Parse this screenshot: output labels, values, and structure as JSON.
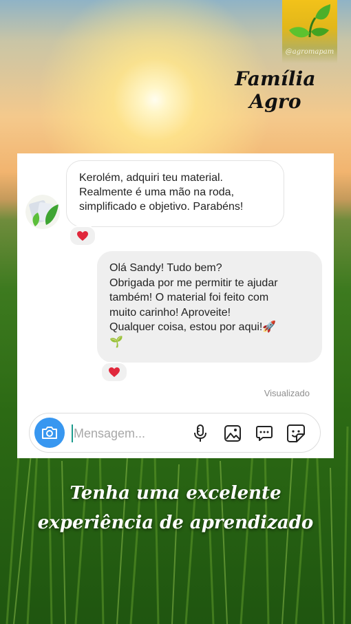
{
  "brand": {
    "handle": "@agromapam",
    "title": "Família Agro"
  },
  "chat": {
    "incoming": {
      "lines": [
        "Kerolém, adquiri teu material.",
        "Realmente é uma mão na roda,",
        "simplificado e objetivo. Parabéns!"
      ],
      "reaction": "heart"
    },
    "outgoing": {
      "lines": [
        "Olá Sandy! Tudo bem?",
        "Obrigada por me permitir te ajudar",
        "também! O material foi feito com",
        "muito carinho! Aproveite!",
        "Qualquer coisa, estou por aqui!🚀",
        "🌱"
      ],
      "reaction": "heart"
    },
    "status": "Visualizado"
  },
  "composer": {
    "placeholder": "Mensagem...",
    "icons": [
      "camera-icon",
      "microphone-icon",
      "image-icon",
      "chat-bubble-icon",
      "sticker-icon"
    ],
    "accent": "#3897f0"
  },
  "tagline": {
    "line1": "Tenha uma excelente",
    "line2": "experiência de aprendizado"
  }
}
